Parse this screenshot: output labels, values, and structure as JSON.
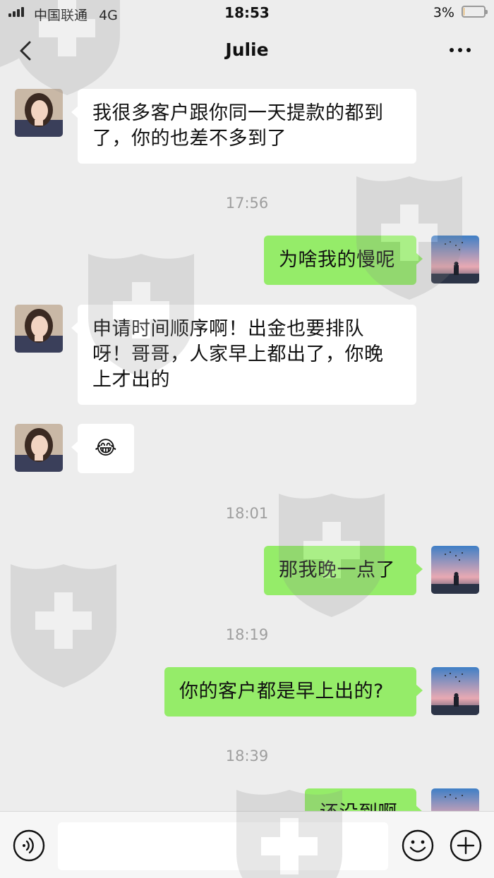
{
  "status_bar": {
    "carrier": "中国联通",
    "network": "4G",
    "time": "18:53",
    "battery_percent": "3%",
    "battery_level": 0.03
  },
  "header": {
    "title": "Julie"
  },
  "messages": [
    {
      "kind": "message",
      "side": "in",
      "text": "我很多客户跟你同一天提款的都到了，你的也差不多到了"
    },
    {
      "kind": "timestamp",
      "text": "17:56"
    },
    {
      "kind": "message",
      "side": "out",
      "text": "为啥我的慢呢"
    },
    {
      "kind": "message",
      "side": "in",
      "text": "申请时间顺序啊！出金也要排队呀！哥哥，人家早上都出了，你晚上才出的"
    },
    {
      "kind": "message",
      "side": "in",
      "text": "😂"
    },
    {
      "kind": "timestamp",
      "text": "18:01"
    },
    {
      "kind": "message",
      "side": "out",
      "text": "那我晚一点了"
    },
    {
      "kind": "timestamp",
      "text": "18:19"
    },
    {
      "kind": "message",
      "side": "out",
      "text": "你的客户都是早上出的?"
    },
    {
      "kind": "timestamp",
      "text": "18:39"
    },
    {
      "kind": "message",
      "side": "out",
      "text": "还没到啊"
    }
  ],
  "icons": {
    "voice": "voice-icon",
    "emoji": "emoji-icon",
    "add": "plus-icon",
    "back": "back-arrow-icon",
    "more": "more-dots-icon"
  },
  "colors": {
    "outgoing_bubble": "#95ec69",
    "incoming_bubble": "#ffffff",
    "background": "#ededed"
  }
}
